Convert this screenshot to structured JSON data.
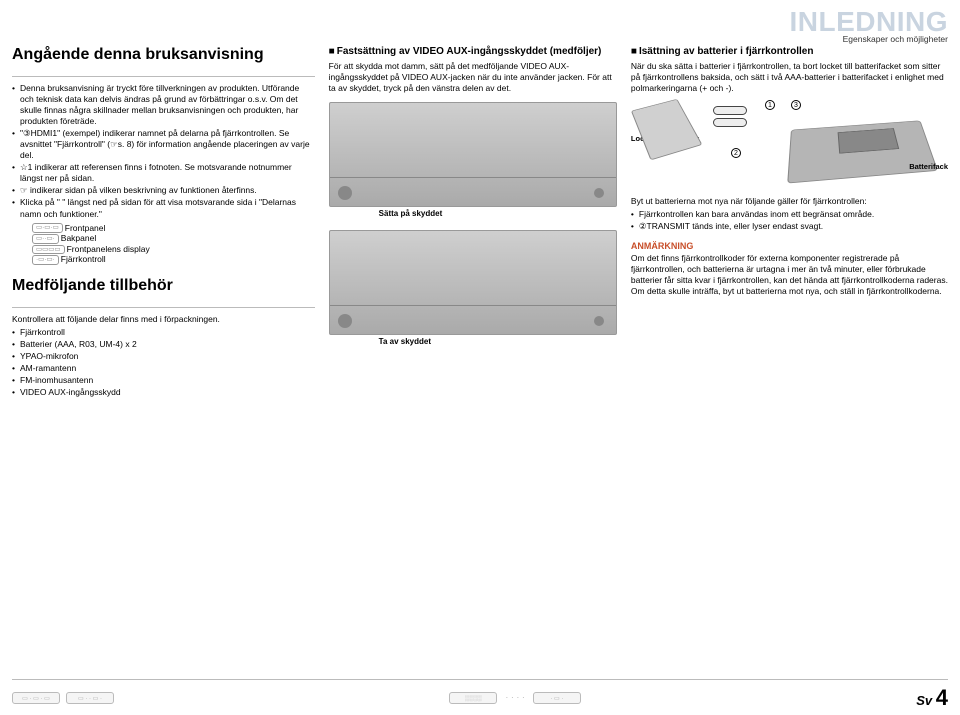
{
  "header": {
    "title": "INLEDNING",
    "subtitle": "Egenskaper och möjligheter"
  },
  "col1": {
    "title": "Angående denna bruksanvisning",
    "bullets": [
      "Denna bruksanvisning är tryckt före tillverkningen av produkten. Utförande och teknisk data kan delvis ändras på grund av förbättringar o.s.v. Om det skulle finnas några skillnader mellan bruksanvisningen och produkten, har produkten företräde.",
      "\"③HDMI1\" (exempel) indikerar namnet på delarna på fjärrkontrollen. Se avsnittet \"Fjärrkontroll\" (☞s. 8) för information angående placeringen av varje del.",
      "☆1 indikerar att referensen finns i fotnoten. Se motsvarande notnummer längst ner på sidan.",
      "☞ indikerar sidan på vilken beskrivning av funktionen återfinns.",
      "Klicka på \"                \" längst ned på sidan för att visa motsvarande sida i \"Delarnas namn och funktioner.\""
    ],
    "tags": {
      "front": "Frontpanel",
      "back": "Bakpanel",
      "display": "Frontpanelens display",
      "remote": "Fjärrkontroll"
    },
    "acc_title": "Medföljande tillbehör",
    "acc_intro": "Kontrollera att följande delar finns med i förpackningen.",
    "acc_items": [
      "Fjärrkontroll",
      "Batterier (AAA, R03, UM-4) x 2",
      "YPAO-mikrofon",
      "AM-ramantenn",
      "FM-inomhusantenn",
      "VIDEO AUX-ingångsskydd"
    ]
  },
  "col2": {
    "title": "Fastsättning av VIDEO AUX-ingångsskyddet (medföljer)",
    "body": "För att skydda mot damm, sätt på det medföljande VIDEO AUX-ingångsskyddet på VIDEO AUX-jacken när du inte använder jacken. För att ta av skyddet, tryck på den vänstra delen av det.",
    "cap1": "Sätta på skyddet",
    "cap2": "Ta av skyddet"
  },
  "col3": {
    "title": "Isättning av batterier i fjärrkontrollen",
    "body": "När du ska sätta i batterier i fjärrkontrollen, ta bort locket till batterifacket som sitter på fjärrkontrollens baksida, och sätt i två AAA-batterier i batterifacket i enlighet med polmarkeringarna (+ och -).",
    "diag": {
      "lock": "Lock till batterifack",
      "comp": "Batterifack",
      "n1": "1",
      "n2": "2",
      "n3": "3"
    },
    "replace_intro": "Byt ut batterierna mot nya när följande gäller för fjärrkontrollen:",
    "replace_items": [
      "Fjärrkontrollen kan bara användas inom ett begränsat område.",
      "②TRANSMIT tänds inte, eller lyser endast svagt."
    ],
    "note_title": "ANMÄRKNING",
    "note_body": "Om det finns fjärrkontrollkoder för externa komponenter registrerade på fjärrkontrollen, och batterierna är urtagna i mer än två minuter, eller förbrukade batterier får sitta kvar i fjärrkontrollen, kan det hända att fjärrkontrollkoderna raderas. Om detta skulle inträffa, byt ut batterierna mot nya, och ställ in fjärrkontrollkoderna."
  },
  "footer": {
    "lang": "Sv",
    "page": "4"
  }
}
